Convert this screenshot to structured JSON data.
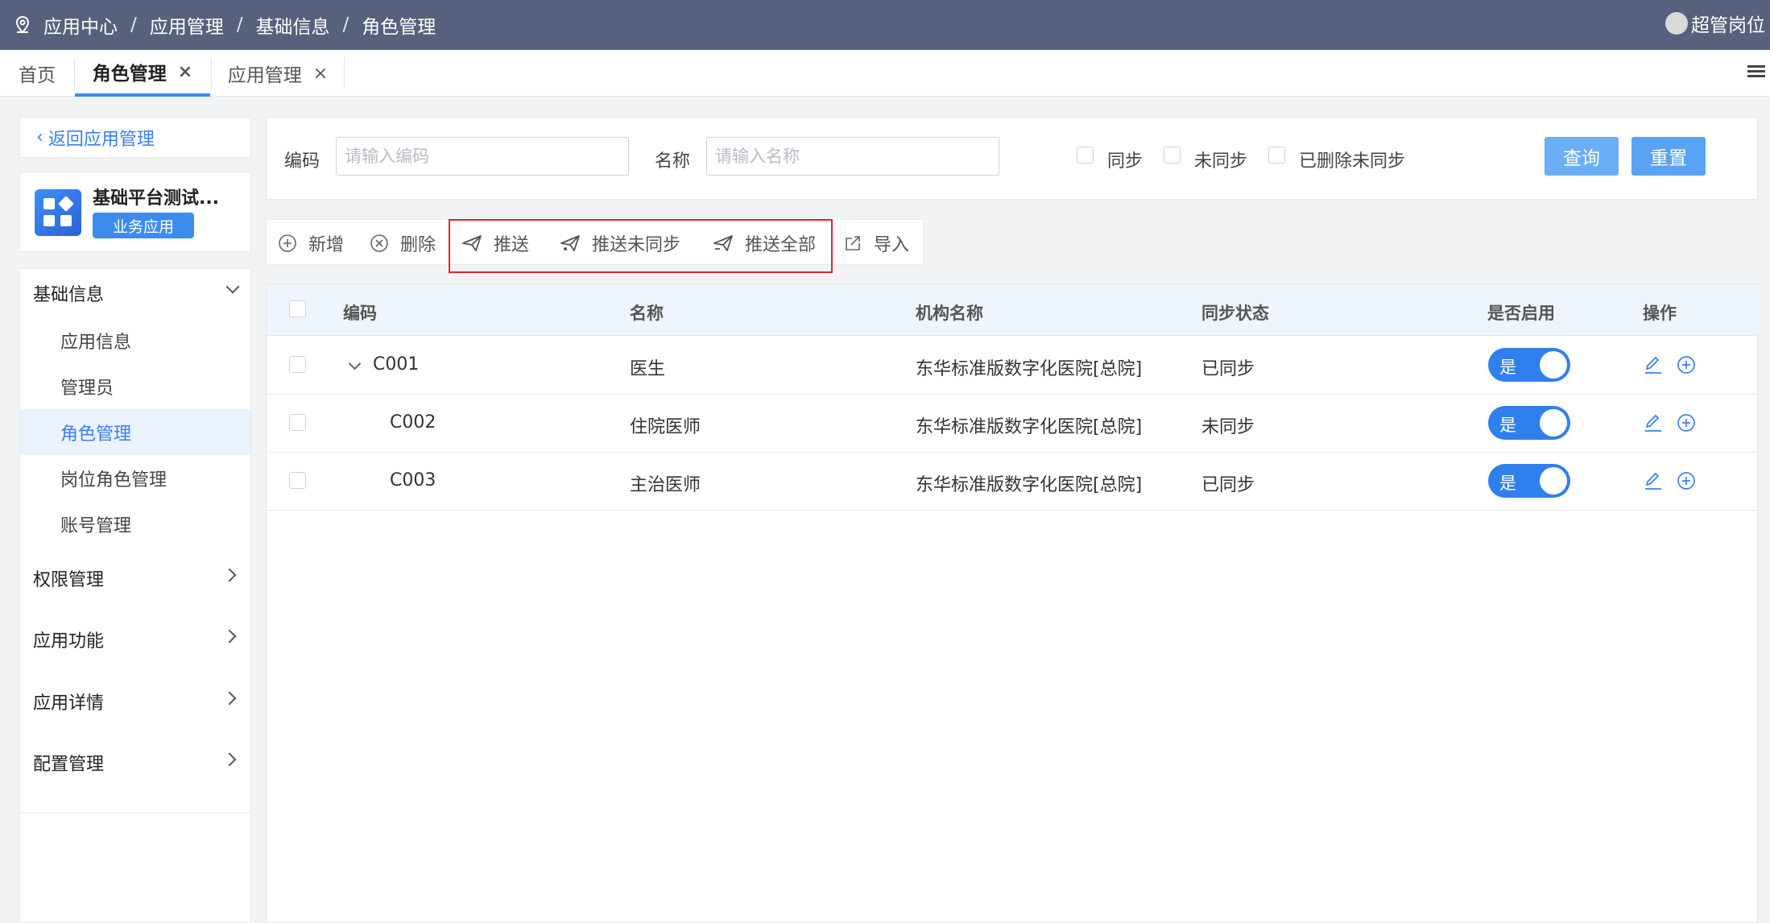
{
  "breadcrumb": [
    "应用中心",
    "应用管理",
    "基础信息",
    "角色管理"
  ],
  "breadcrumb_sep": "/",
  "user": {
    "name": "超管岗位"
  },
  "tabs": [
    {
      "label": "首页",
      "closable": false
    },
    {
      "label": "角色管理",
      "closable": true,
      "active": true
    },
    {
      "label": "应用管理",
      "closable": true
    }
  ],
  "tab_close": "×",
  "sidebar": {
    "back_label": "返回应用管理",
    "app_name": "基础平台测试...",
    "app_tag": "业务应用",
    "groups": [
      {
        "label": "基础信息",
        "expanded": true
      },
      {
        "label": "权限管理"
      },
      {
        "label": "应用功能"
      },
      {
        "label": "应用详情"
      },
      {
        "label": "配置管理"
      }
    ],
    "items": [
      "应用信息",
      "管理员",
      "角色管理",
      "岗位角色管理",
      "账号管理"
    ],
    "active_item": "角色管理"
  },
  "search": {
    "code_label": "编码",
    "code_placeholder": "请输入编码",
    "name_label": "名称",
    "name_placeholder": "请输入名称",
    "checks": [
      "同步",
      "未同步",
      "已删除未同步"
    ],
    "query_label": "查询",
    "reset_label": "重置"
  },
  "toolbar": {
    "add": "新增",
    "delete": "删除",
    "push": "推送",
    "push_unsynced": "推送未同步",
    "push_all": "推送全部",
    "import": "导入"
  },
  "table": {
    "headers": [
      "编码",
      "名称",
      "机构名称",
      "同步状态",
      "是否启用",
      "操作"
    ],
    "rows": [
      {
        "code": "C001",
        "name": "医生",
        "org": "东华标准版数字化医院[总院]",
        "status": "已同步",
        "enabled": "是",
        "expanded": true
      },
      {
        "code": "C002",
        "name": "住院医师",
        "org": "东华标准版数字化医院[总院]",
        "status": "未同步",
        "enabled": "是"
      },
      {
        "code": "C003",
        "name": "主治医师",
        "org": "东华标准版数字化医院[总院]",
        "status": "已同步",
        "enabled": "是"
      }
    ]
  },
  "colors": {
    "topbar": "#56617d",
    "accent": "#3c8cf0",
    "highlight_box": "#e0262c",
    "switch_on": "#2f80ed"
  }
}
